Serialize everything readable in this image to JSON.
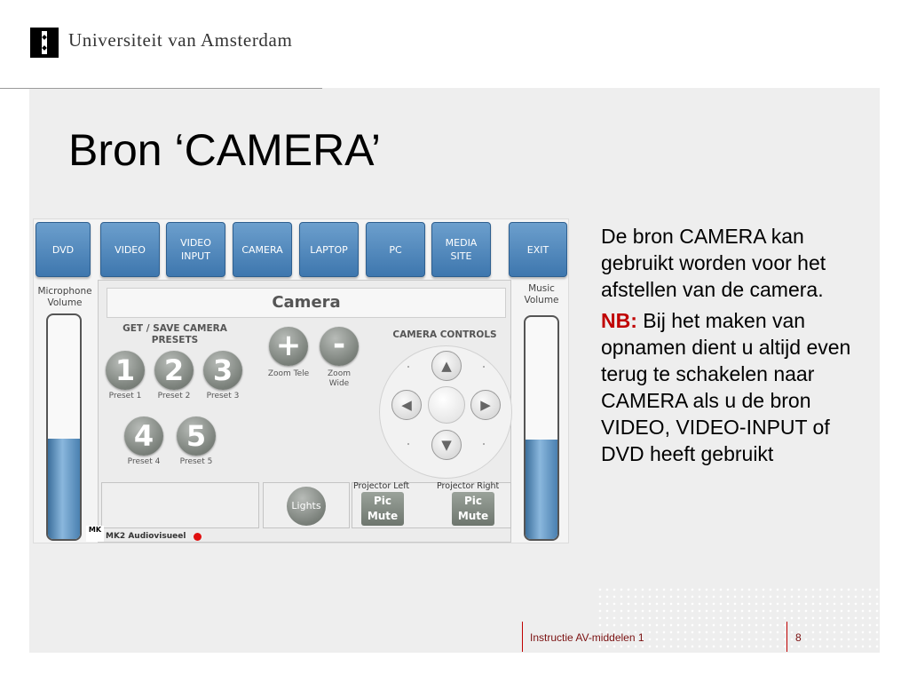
{
  "header": {
    "institution": "Universiteit van Amsterdam",
    "logo_icon": "uva-crest-icon"
  },
  "slide": {
    "title": "Bron ‘CAMERA’",
    "paragraph1": "De bron CAMERA kan gebruikt worden voor het afstellen van de camera.",
    "nb_label": "NB:",
    "paragraph2": "Bij het maken van opnamen dient u altijd even terug te schakelen naar CAMERA als u de bron VIDEO, VIDEO-INPUT of DVD heeft gebruikt"
  },
  "footer": {
    "course": "Instructie AV-middelen 1",
    "page": "8"
  },
  "panel": {
    "sources": [
      "DVD",
      "VIDEO",
      "VIDEO INPUT",
      "CAMERA",
      "LAPTOP",
      "PC",
      "MEDIA SITE"
    ],
    "exit_label": "EXIT",
    "mic_volume_label": "Microphone Volume",
    "music_volume_label": "Music Volume",
    "mic_volume_level": 0.45,
    "music_volume_level": 0.45,
    "camera_heading": "Camera",
    "presets_heading": "GET / SAVE CAMERA PRESETS",
    "presets": [
      {
        "number": "1",
        "label": "Preset 1"
      },
      {
        "number": "2",
        "label": "Preset 2"
      },
      {
        "number": "3",
        "label": "Preset 3"
      },
      {
        "number": "4",
        "label": "Preset 4"
      },
      {
        "number": "5",
        "label": "Preset 5"
      }
    ],
    "zoom_tele_symbol": "+",
    "zoom_tele_label": "Zoom Tele",
    "zoom_wide_symbol": "-",
    "zoom_wide_label": "Zoom Wide",
    "camera_controls_heading": "CAMERA CONTROLS",
    "lights_label": "Lights",
    "projector_left_label": "Projector Left",
    "projector_right_label": "Projector Right",
    "pic_mute_label": "Pic Mute",
    "brand_logo_text": "MK",
    "brand_text": "MK2 Audiovisueel",
    "colors": {
      "source_button": "#4f86bb",
      "preset_button": "#7a807a",
      "nb_red": "#c00000",
      "status_dot": "#e01010"
    }
  }
}
